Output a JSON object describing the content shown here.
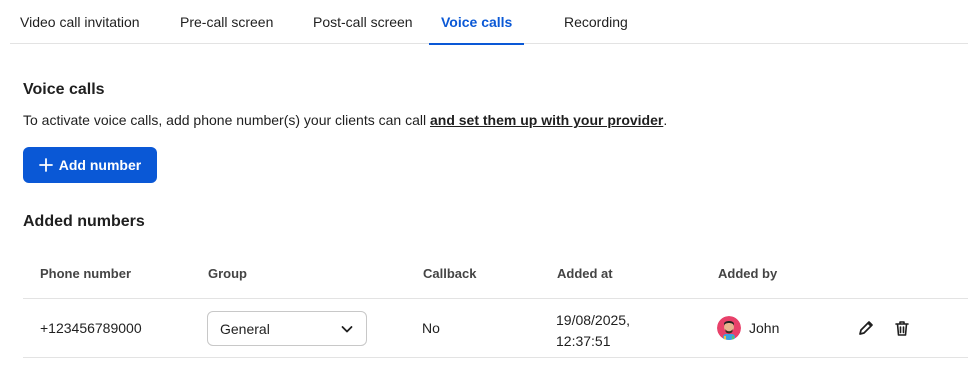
{
  "tabs": [
    {
      "label": "Video call invitation",
      "active": false
    },
    {
      "label": "Pre-call screen",
      "active": false
    },
    {
      "label": "Post-call screen",
      "active": false
    },
    {
      "label": "Voice calls",
      "active": true
    },
    {
      "label": "Recording",
      "active": false
    }
  ],
  "section": {
    "title": "Voice calls",
    "description": "To activate voice calls, add phone number(s) your clients can call ",
    "description_link": "and set them up with your provider",
    "description_end": "."
  },
  "add_button": {
    "label": "Add number",
    "icon": "plus-icon"
  },
  "added_numbers": {
    "title": "Added numbers",
    "columns": [
      "Phone number",
      "Group",
      "Callback",
      "Added at",
      "Added by"
    ],
    "rows": [
      {
        "phone": "+123456789000",
        "group": "General",
        "callback": "No",
        "added_at_date": "19/08/2025,",
        "added_at_time": "12:37:51",
        "added_by": "John"
      }
    ]
  },
  "colors": {
    "accent": "#0a58d6",
    "border": "#e3e3e3"
  }
}
